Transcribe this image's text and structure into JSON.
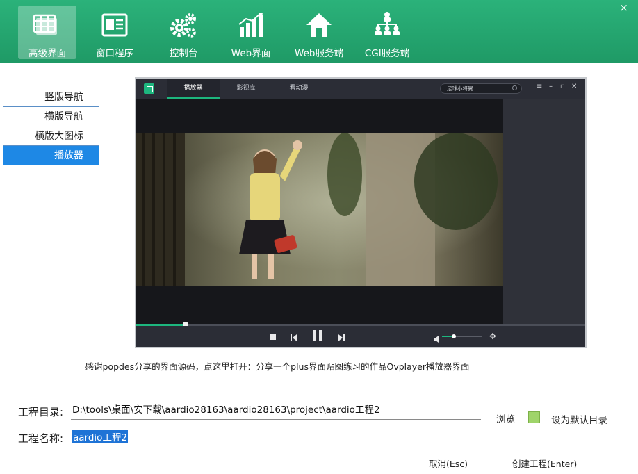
{
  "toolbar": {
    "items": [
      {
        "label": "高级界面",
        "icon": "grid-table-icon"
      },
      {
        "label": "窗口程序",
        "icon": "window-newspaper-icon"
      },
      {
        "label": "控制台",
        "icon": "gears-icon"
      },
      {
        "label": "Web界面",
        "icon": "bar-chart-icon"
      },
      {
        "label": "Web服务端",
        "icon": "home-icon"
      },
      {
        "label": "CGI服务端",
        "icon": "org-tree-icon"
      }
    ],
    "close_glyph": "×",
    "accent": "#1f9a66"
  },
  "nav": {
    "items": [
      "竖版导航",
      "横版导航",
      "横版大图标",
      "播放器"
    ],
    "selected": "播放器",
    "selected_color": "#1e88e5"
  },
  "preview": {
    "tabs": [
      "播放器",
      "影视库",
      "看动漫"
    ],
    "active_tab": "播放器",
    "search_text": "足球小将翼",
    "progress": 0.11,
    "volume": 0.3
  },
  "caption": "感谢popdes分享的界面源码，点这里打开：分享一个plus界面贴图练习的作品Ovplayer播放器界面",
  "form": {
    "dir_label": "工程目录:",
    "dir_value": "D:\\tools\\桌面\\安下载\\aardio28163\\aardio28163\\project\\aardio工程2",
    "name_label": "工程名称:",
    "name_value": "aardio工程2",
    "browse": "浏览",
    "default_dir": "设为默认目录",
    "cancel": "取消(Esc)",
    "create": "创建工程(Enter)"
  }
}
